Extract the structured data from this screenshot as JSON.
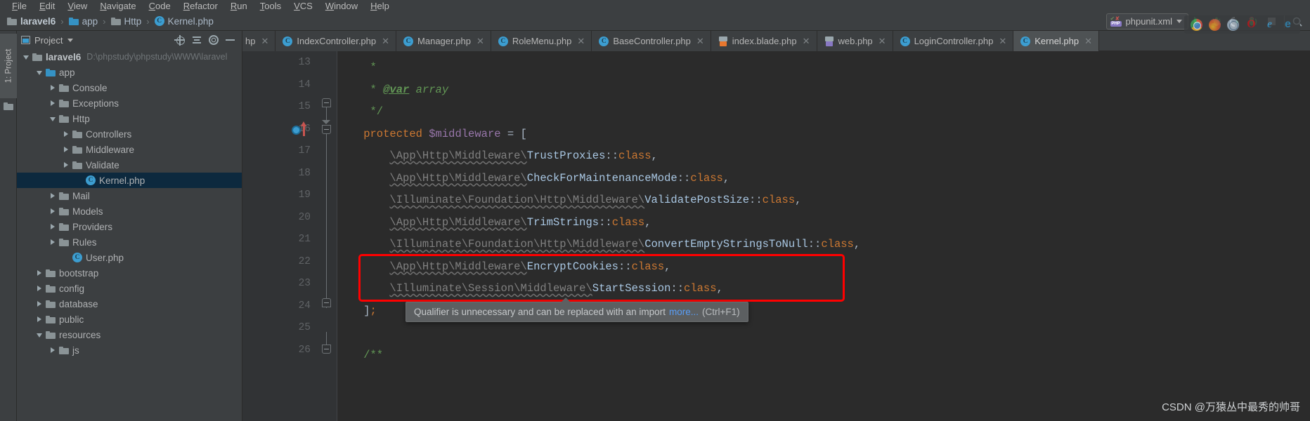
{
  "menubar": {
    "items": [
      "File",
      "Edit",
      "View",
      "Navigate",
      "Code",
      "Refactor",
      "Run",
      "Tools",
      "VCS",
      "Window",
      "Help"
    ]
  },
  "breadcrumb": {
    "items": [
      {
        "label": "laravel6",
        "icon": "folder-icon",
        "bold": true
      },
      {
        "label": "app",
        "icon": "folder-icon-blue",
        "bold": false
      },
      {
        "label": "Http",
        "icon": "folder-icon",
        "bold": false
      },
      {
        "label": "Kernel.php",
        "icon": "php-class-icon",
        "bold": false
      }
    ],
    "separator": "›"
  },
  "runbar": {
    "config_name": "phpunit.xml",
    "config_icon": "phpunit-icon",
    "php_badge": "PHP",
    "buttons": [
      {
        "name": "run-button",
        "icon": "run-triangle-icon"
      },
      {
        "name": "debug-button",
        "icon": "debug-bug-icon"
      },
      {
        "name": "run-with-coverage-button",
        "icon": "coverage-icon"
      },
      {
        "name": "profile-button",
        "icon": "profile-icon"
      },
      {
        "name": "stop-button",
        "icon": "stop-square-icon"
      }
    ]
  },
  "toolstrip": {
    "project_tab": "1: Project"
  },
  "project_panel": {
    "title": "Project",
    "actions": [
      "locate-icon",
      "collapse-all-icon",
      "minimize-icon",
      "settings-gear-icon"
    ],
    "tree": [
      {
        "label": "laravel6",
        "path": "D:\\phpstudy\\phpstudy\\WWW\\laravel",
        "type": "folder",
        "state": "expanded",
        "depth": 0,
        "bold": true
      },
      {
        "label": "app",
        "path": "",
        "type": "folder-blue",
        "state": "expanded",
        "depth": 1,
        "bold": false
      },
      {
        "label": "Console",
        "path": "",
        "type": "folder",
        "state": "collapsed",
        "depth": 2,
        "bold": false
      },
      {
        "label": "Exceptions",
        "path": "",
        "type": "folder",
        "state": "collapsed",
        "depth": 2,
        "bold": false
      },
      {
        "label": "Http",
        "path": "",
        "type": "folder",
        "state": "expanded",
        "depth": 2,
        "bold": false
      },
      {
        "label": "Controllers",
        "path": "",
        "type": "folder",
        "state": "collapsed",
        "depth": 3,
        "bold": false
      },
      {
        "label": "Middleware",
        "path": "",
        "type": "folder",
        "state": "collapsed",
        "depth": 3,
        "bold": false
      },
      {
        "label": "Validate",
        "path": "",
        "type": "folder",
        "state": "collapsed",
        "depth": 3,
        "bold": false
      },
      {
        "label": "Kernel.php",
        "path": "",
        "type": "php-class",
        "state": "leaf",
        "depth": 4,
        "bold": false,
        "selected": true
      },
      {
        "label": "Mail",
        "path": "",
        "type": "folder",
        "state": "collapsed",
        "depth": 2,
        "bold": false
      },
      {
        "label": "Models",
        "path": "",
        "type": "folder",
        "state": "collapsed",
        "depth": 2,
        "bold": false
      },
      {
        "label": "Providers",
        "path": "",
        "type": "folder",
        "state": "collapsed",
        "depth": 2,
        "bold": false
      },
      {
        "label": "Rules",
        "path": "",
        "type": "folder",
        "state": "collapsed",
        "depth": 2,
        "bold": false
      },
      {
        "label": "User.php",
        "path": "",
        "type": "php-class",
        "state": "leaf",
        "depth": 3,
        "bold": false
      },
      {
        "label": "bootstrap",
        "path": "",
        "type": "folder",
        "state": "collapsed",
        "depth": 1,
        "bold": false
      },
      {
        "label": "config",
        "path": "",
        "type": "folder",
        "state": "collapsed",
        "depth": 1,
        "bold": false
      },
      {
        "label": "database",
        "path": "",
        "type": "folder",
        "state": "collapsed",
        "depth": 1,
        "bold": false
      },
      {
        "label": "public",
        "path": "",
        "type": "folder",
        "state": "collapsed",
        "depth": 1,
        "bold": false
      },
      {
        "label": "resources",
        "path": "",
        "type": "folder",
        "state": "expanded",
        "depth": 1,
        "bold": false
      },
      {
        "label": "js",
        "path": "",
        "type": "folder",
        "state": "collapsed",
        "depth": 2,
        "bold": false
      }
    ]
  },
  "editor_tabs": [
    {
      "label": "hp",
      "icon": "php-class-icon",
      "active": false,
      "partial": true
    },
    {
      "label": "IndexController.php",
      "icon": "php-class-icon",
      "active": false,
      "partial": false
    },
    {
      "label": "Manager.php",
      "icon": "php-class-icon",
      "active": false,
      "partial": false
    },
    {
      "label": "RoleMenu.php",
      "icon": "php-class-icon",
      "active": false,
      "partial": false
    },
    {
      "label": "BaseController.php",
      "icon": "php-class-icon",
      "active": false,
      "partial": false
    },
    {
      "label": "index.blade.php",
      "icon": "blade-file-icon",
      "active": false,
      "partial": false
    },
    {
      "label": "web.php",
      "icon": "php-file-icon",
      "active": false,
      "partial": false
    },
    {
      "label": "LoginController.php",
      "icon": "php-class-icon",
      "active": false,
      "partial": false
    },
    {
      "label": "Kernel.php",
      "icon": "php-class-icon",
      "active": true,
      "partial": false
    }
  ],
  "editor": {
    "line_numbers": [
      "13",
      "14",
      "15",
      "16",
      "17",
      "18",
      "19",
      "20",
      "21",
      "22",
      "23",
      "24",
      "25",
      "26"
    ],
    "lines": [
      {
        "n": "13",
        "segments": [
          {
            "t": "     *",
            "c": "c-comment"
          }
        ]
      },
      {
        "n": "14",
        "segments": [
          {
            "t": "     * ",
            "c": "c-comment"
          },
          {
            "t": "@var",
            "c": "c-doctag"
          },
          {
            "t": " array",
            "c": "c-docval"
          }
        ]
      },
      {
        "n": "15",
        "segments": [
          {
            "t": "     */",
            "c": "c-comment"
          }
        ]
      },
      {
        "n": "16",
        "segments": [
          {
            "t": "    protected",
            "c": "c-kw"
          },
          {
            "t": " ",
            "c": "c-punct"
          },
          {
            "t": "$middleware",
            "c": "c-var"
          },
          {
            "t": " = [",
            "c": "c-punct"
          }
        ]
      },
      {
        "n": "17",
        "segments": [
          {
            "t": "        ",
            "c": "c-punct"
          },
          {
            "t": "\\App\\Http\\Middleware\\",
            "c": "c-ns squig"
          },
          {
            "t": "TrustProxies",
            "c": "c-cls"
          },
          {
            "t": "::",
            "c": "c-punct"
          },
          {
            "t": "class",
            "c": "c-class-kw"
          },
          {
            "t": ",",
            "c": "c-punct"
          }
        ]
      },
      {
        "n": "18",
        "segments": [
          {
            "t": "        ",
            "c": "c-punct"
          },
          {
            "t": "\\App\\Http\\Middleware\\",
            "c": "c-ns squig"
          },
          {
            "t": "CheckForMaintenanceMode",
            "c": "c-cls"
          },
          {
            "t": "::",
            "c": "c-punct"
          },
          {
            "t": "class",
            "c": "c-class-kw"
          },
          {
            "t": ",",
            "c": "c-punct"
          }
        ]
      },
      {
        "n": "19",
        "segments": [
          {
            "t": "        ",
            "c": "c-punct"
          },
          {
            "t": "\\Illuminate\\Foundation\\Http\\Middleware\\",
            "c": "c-ns squig"
          },
          {
            "t": "ValidatePostSize",
            "c": "c-cls"
          },
          {
            "t": "::",
            "c": "c-punct"
          },
          {
            "t": "class",
            "c": "c-class-kw"
          },
          {
            "t": ",",
            "c": "c-punct"
          }
        ]
      },
      {
        "n": "20",
        "segments": [
          {
            "t": "        ",
            "c": "c-punct"
          },
          {
            "t": "\\App\\Http\\Middleware\\",
            "c": "c-ns squig"
          },
          {
            "t": "TrimStrings",
            "c": "c-cls"
          },
          {
            "t": "::",
            "c": "c-punct"
          },
          {
            "t": "class",
            "c": "c-class-kw"
          },
          {
            "t": ",",
            "c": "c-punct"
          }
        ]
      },
      {
        "n": "21",
        "segments": [
          {
            "t": "        ",
            "c": "c-punct"
          },
          {
            "t": "\\Illuminate\\Foundation\\Http\\Middleware\\",
            "c": "c-ns squig"
          },
          {
            "t": "ConvertEmptyStringsToNull",
            "c": "c-cls"
          },
          {
            "t": "::",
            "c": "c-punct"
          },
          {
            "t": "class",
            "c": "c-class-kw"
          },
          {
            "t": ",",
            "c": "c-punct"
          }
        ]
      },
      {
        "n": "22",
        "segments": [
          {
            "t": "        ",
            "c": "c-punct"
          },
          {
            "t": "\\App\\Http\\Middleware\\",
            "c": "c-ns squig"
          },
          {
            "t": "EncryptCookies",
            "c": "c-cls"
          },
          {
            "t": "::",
            "c": "c-punct"
          },
          {
            "t": "class",
            "c": "c-class-kw"
          },
          {
            "t": ",",
            "c": "c-punct"
          }
        ]
      },
      {
        "n": "23",
        "segments": [
          {
            "t": "        ",
            "c": "c-punct"
          },
          {
            "t": "\\Illuminate\\Session\\Middleware\\",
            "c": "c-ns squig"
          },
          {
            "t": "StartSession",
            "c": "c-cls"
          },
          {
            "t": "::",
            "c": "c-punct"
          },
          {
            "t": "class",
            "c": "c-class-kw"
          },
          {
            "t": ",",
            "c": "c-punct"
          }
        ]
      },
      {
        "n": "24",
        "segments": [
          {
            "t": "    ]",
            "c": "c-punct"
          },
          {
            "t": ";",
            "c": "c-kw"
          }
        ]
      },
      {
        "n": "25",
        "segments": [
          {
            "t": "",
            "c": "c-punct"
          }
        ]
      },
      {
        "n": "26",
        "segments": [
          {
            "t": "    /**",
            "c": "c-comment"
          }
        ]
      }
    ]
  },
  "tooltip": {
    "text": "Qualifier is unnecessary and can be replaced with an import",
    "link": "more...",
    "hint": "(Ctrl+F1)"
  },
  "browsers": [
    {
      "name": "chrome-icon",
      "glyph": ""
    },
    {
      "name": "firefox-icon",
      "glyph": ""
    },
    {
      "name": "safari-icon",
      "glyph": ""
    },
    {
      "name": "opera-icon",
      "glyph": "O"
    },
    {
      "name": "internet-explorer-icon",
      "glyph": "e"
    },
    {
      "name": "edge-icon",
      "glyph": "e"
    }
  ],
  "watermark": "CSDN @万猿丛中最秀的帅哥",
  "colors": {
    "background": "#3c3f41",
    "editor_background": "#2b2b2b",
    "accent_blue": "#3c9dd0",
    "annotation_red": "#ff0000",
    "selection_blue": "#0d293e"
  }
}
